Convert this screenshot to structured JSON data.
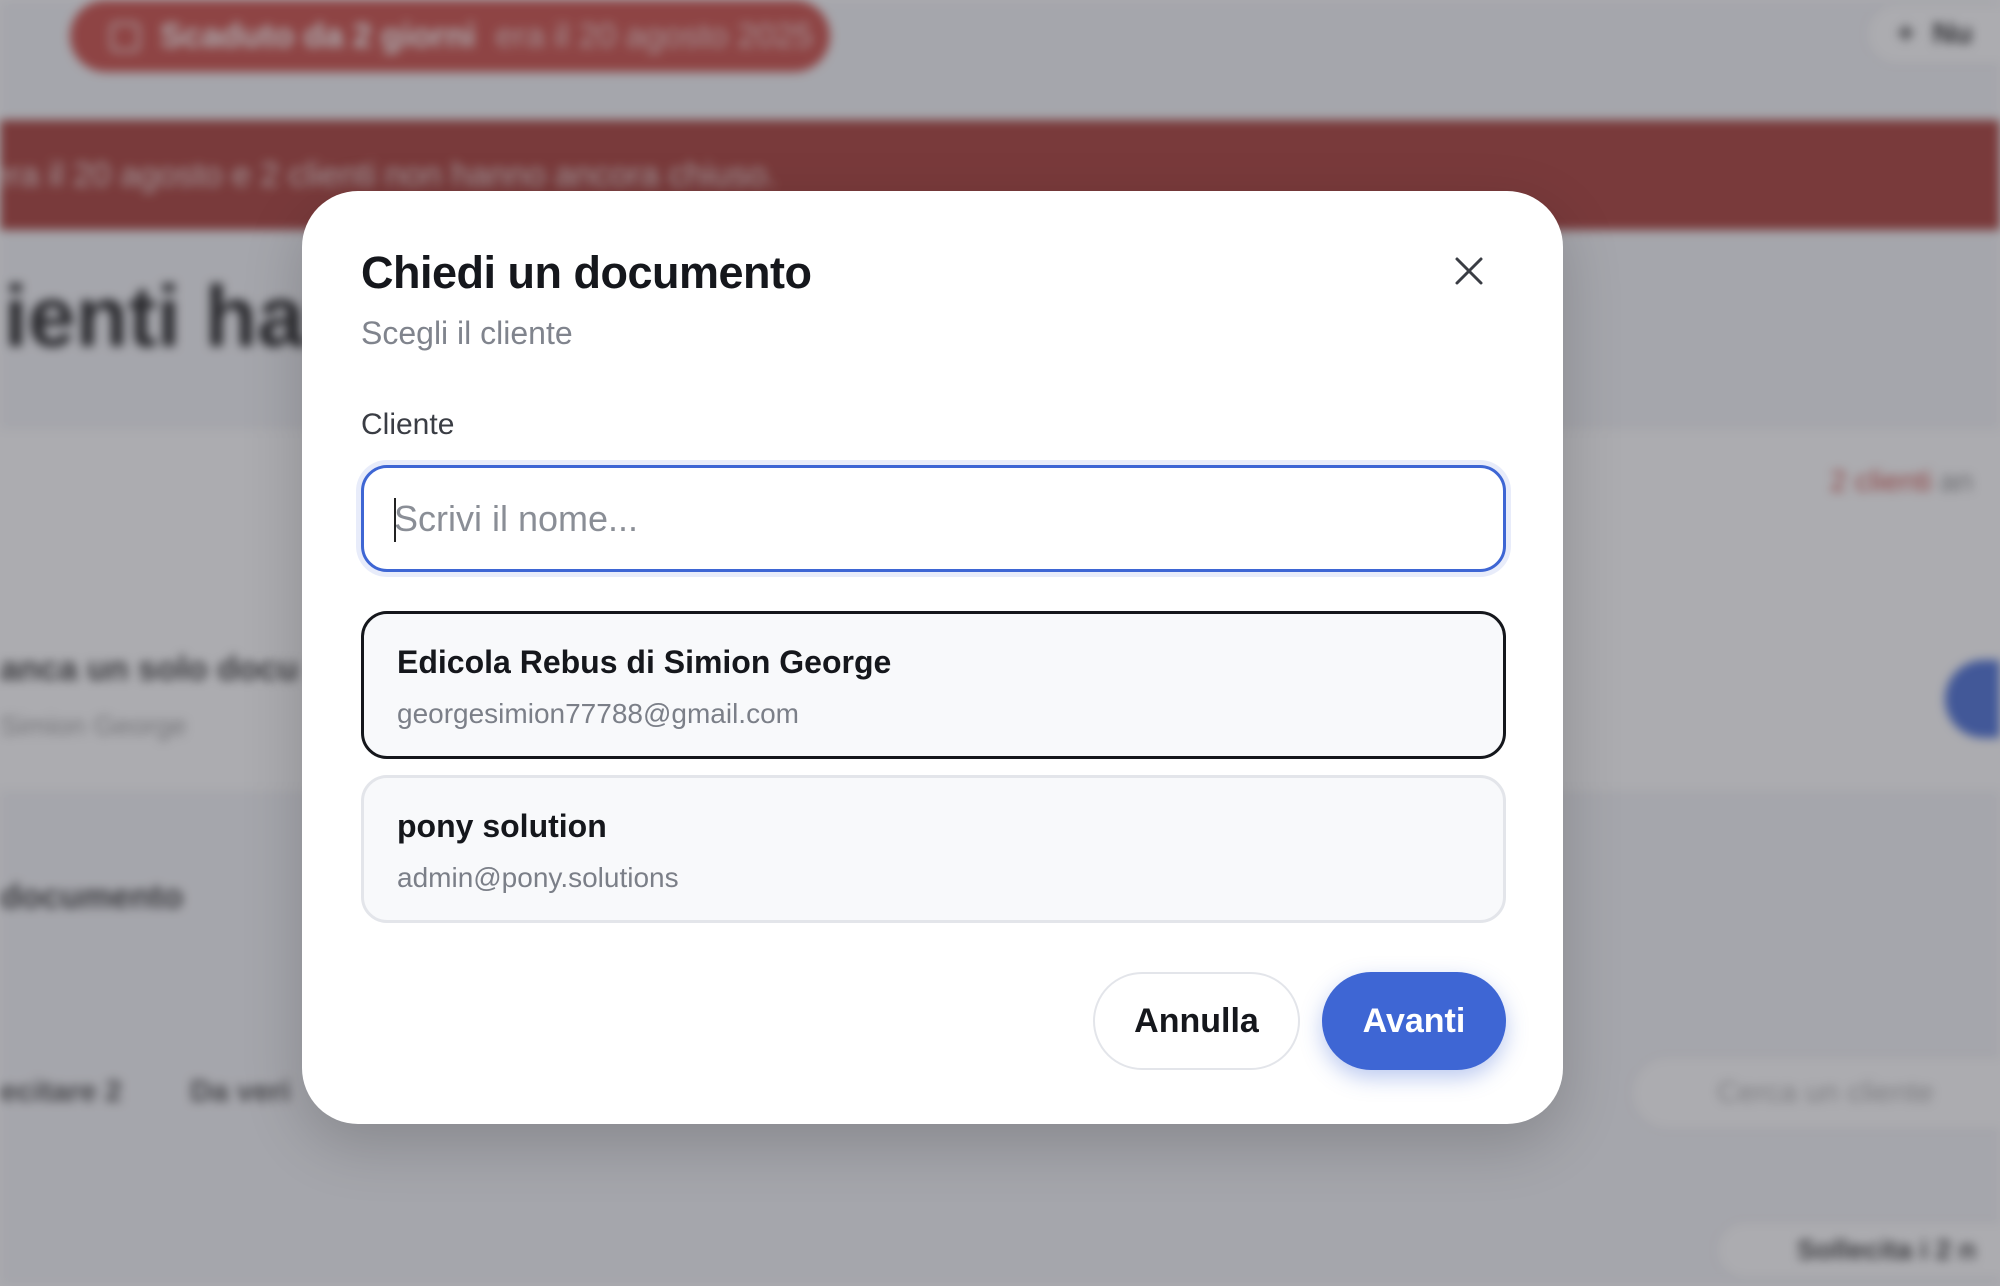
{
  "background": {
    "status_pill": {
      "label": "Scaduto da 2 giorni",
      "sub": "era il 20 agosto 2025"
    },
    "new_button": {
      "label": "Nu"
    },
    "banner": {
      "text": "era il 20 agosto e 2 clienti non hanno ancora chiuso."
    },
    "heading": "lienti han",
    "card_summary": {
      "count": "2 clienti",
      "rest": "an"
    },
    "row": {
      "title": "anca un solo docu",
      "subtitle": "Simion George"
    },
    "section_title": "documento",
    "tabs": [
      "ecitare 2",
      "Da veri"
    ],
    "search_placeholder": "Cerca un cliente",
    "bottom_pill": "Sollecita i 2 n"
  },
  "modal": {
    "title": "Chiedi un documento",
    "subtitle": "Scegli il cliente",
    "close_icon": "close-icon",
    "field_label": "Cliente",
    "search": {
      "placeholder": "Scrivi il nome...",
      "value": ""
    },
    "clients": [
      {
        "name": "Edicola Rebus di Simion George",
        "email": "georgesimion77788@gmail.com",
        "selected": true
      },
      {
        "name": "pony solution",
        "email": "admin@pony.solutions",
        "selected": false
      }
    ],
    "cancel_label": "Annulla",
    "next_label": "Avanti"
  },
  "colors": {
    "accent": "#3e66d4",
    "danger": "#c9423b",
    "text_primary": "#15171c",
    "text_muted": "#80848d"
  }
}
